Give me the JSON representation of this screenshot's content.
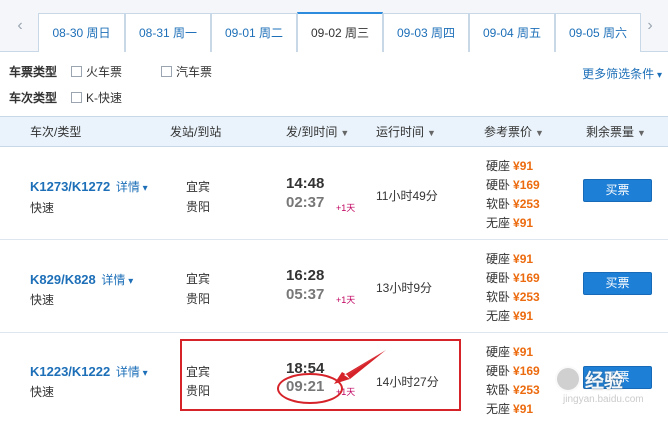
{
  "date_tabs": [
    {
      "label": "08-30 周日",
      "active": false
    },
    {
      "label": "08-31 周一",
      "active": false
    },
    {
      "label": "09-01 周二",
      "active": false
    },
    {
      "label": "09-02 周三",
      "active": true
    },
    {
      "label": "09-03 周四",
      "active": false
    },
    {
      "label": "09-04 周五",
      "active": false
    },
    {
      "label": "09-05 周六",
      "active": false
    }
  ],
  "nav": {
    "prev": "‹",
    "next": "›"
  },
  "filters": {
    "ticket_type_label": "车票类型",
    "ticket_type_options": [
      "火车票",
      "汽车票"
    ],
    "train_type_label": "车次类型",
    "train_type_options": [
      "K-快速"
    ],
    "more_filters": "更多筛选条件"
  },
  "table_header": {
    "train": "车次/类型",
    "stations": "发站/到站",
    "times": "发/到时间",
    "duration": "运行时间",
    "price": "参考票价",
    "remaining": "剩余票量"
  },
  "trains": [
    {
      "number": "K1273/K1272",
      "detail": "详情",
      "type": "快速",
      "from": "宜宾",
      "to": "贵阳",
      "depart": "14:48",
      "arrive": "02:37",
      "plus_day": "+1天",
      "duration": "11小时49分",
      "prices": [
        {
          "seat": "硬座",
          "price": "¥91"
        },
        {
          "seat": "硬卧",
          "price": "¥169"
        },
        {
          "seat": "软卧",
          "price": "¥253"
        },
        {
          "seat": "无座",
          "price": "¥91"
        }
      ],
      "buy": "买票"
    },
    {
      "number": "K829/K828",
      "detail": "详情",
      "type": "快速",
      "from": "宜宾",
      "to": "贵阳",
      "depart": "16:28",
      "arrive": "05:37",
      "plus_day": "+1天",
      "duration": "13小时9分",
      "prices": [
        {
          "seat": "硬座",
          "price": "¥91"
        },
        {
          "seat": "硬卧",
          "price": "¥169"
        },
        {
          "seat": "软卧",
          "price": "¥253"
        },
        {
          "seat": "无座",
          "price": "¥91"
        }
      ],
      "buy": "买票"
    },
    {
      "number": "K1223/K1222",
      "detail": "详情",
      "type": "快速",
      "from": "宜宾",
      "to": "贵阳",
      "depart": "18:54",
      "arrive": "09:21",
      "plus_day": "+1天",
      "duration": "14小时27分",
      "prices": [
        {
          "seat": "硬座",
          "price": "¥91"
        },
        {
          "seat": "硬卧",
          "price": "¥169"
        },
        {
          "seat": "软卧",
          "price": "¥253"
        },
        {
          "seat": "无座",
          "price": "¥91"
        }
      ],
      "buy": "买票"
    }
  ],
  "watermark": {
    "text": "经验",
    "sub": "jingyan.baidu.com"
  },
  "colors": {
    "accent": "#1d7fd6",
    "price": "#ec6b0f",
    "annotation": "#d6232a"
  }
}
